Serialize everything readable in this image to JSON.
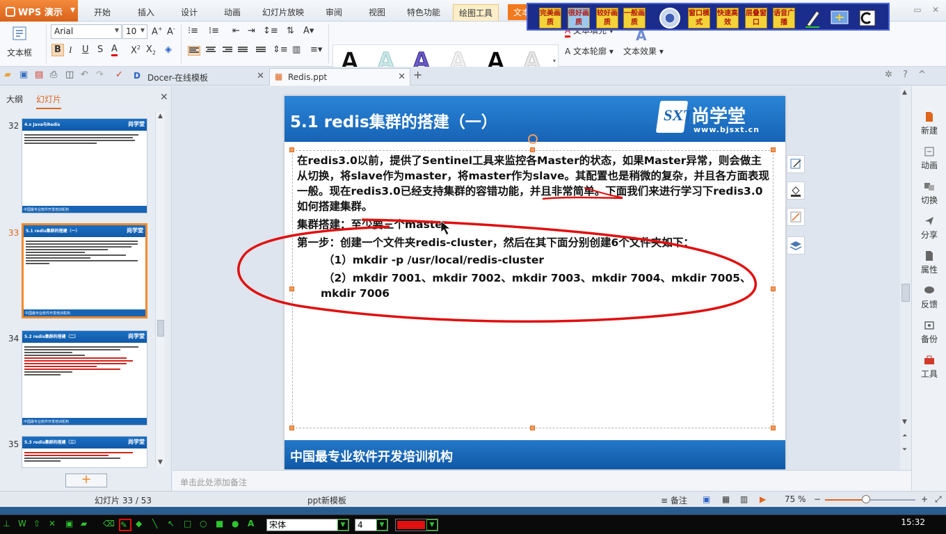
{
  "app": {
    "name": "WPS 演示",
    "menu_tabs": [
      "开始",
      "插入",
      "设计",
      "动画",
      "幻灯片放映",
      "审阅",
      "视图",
      "特色功能",
      "绘图工具",
      "文本"
    ]
  },
  "recorder_toolbar": {
    "buttons": [
      "完美画质",
      "很好画质",
      "较好画质",
      "一般画质",
      "窗口模式",
      "快速高效",
      "层叠窗口",
      "语音广播"
    ]
  },
  "ribbon": {
    "textbox_label": "文本框",
    "font_name": "Arial",
    "font_size": "10",
    "text_outline_label": "文本轮廓",
    "text_effect_label": "文本效果",
    "text_fill_label": "文本填充",
    "wordart_sample": "A"
  },
  "doc_tabs": [
    {
      "label": "Docer-在线模板"
    },
    {
      "label": "Redis.ppt"
    }
  ],
  "left_panel": {
    "tab_outline": "大纲",
    "tab_slides": "幻灯片",
    "thumbnails": [
      {
        "num": "32",
        "title": "4.x Java与Redis",
        "brand": "尚学堂",
        "footer": "中国最专业软件开发培训机构"
      },
      {
        "num": "33",
        "title": "5.1 redis集群的搭建（一）",
        "brand": "尚学堂",
        "footer": "中国最专业软件开发培训机构"
      },
      {
        "num": "34",
        "title": "5.2 redis集群的搭建（二）",
        "brand": "尚学堂",
        "footer": "中国最专业软件开发培训机构"
      },
      {
        "num": "35",
        "title": "5.3 redis集群的搭建（三）",
        "brand": "尚学堂",
        "footer": ""
      }
    ]
  },
  "slide": {
    "title": "5.1 redis集群的搭建（一）",
    "brand": "尚学堂",
    "logo_letters": "SXT",
    "url": "www.bjsxt.cn",
    "paragraph": "在redis3.0以前，提供了Sentinel工具来监控各Master的状态，如果Master异常，则会做主从切换，将slave作为master，将master作为slave。其配置也是稍微的复杂，并且各方面表现一般。现在redis3.0已经支持集群的容错功能，并且非常简单。下面我们来进行学习下redis3.0如何搭建集群。",
    "line2": "集群搭建：至少要三个master",
    "line3": "第一步：创建一个文件夹redis-cluster，然后在其下面分别创建6个文件夹如下：",
    "step1": "（1）mkdir -p /usr/local/redis-cluster",
    "step2a": "（2）mkdir 7001、mkdir 7002、mkdir 7003、mkdir 7004、mkdir 7005、",
    "step2b": "mkdir 7006",
    "footer": "中国最专业软件开发培训机构"
  },
  "task_pane": [
    "新建",
    "动画",
    "切换",
    "分享",
    "属性",
    "反馈",
    "备份",
    "工具"
  ],
  "notes_placeholder": "单击此处添加备注",
  "status": {
    "slide_counter": "幻灯片 33 / 53",
    "template": "ppt新模板",
    "notes_label": "备注",
    "zoom": "75 %",
    "zoom_level": 0.45
  },
  "anno_toolbar": {
    "font": "宋体",
    "size": "4"
  },
  "clock": "15:32",
  "colors": {
    "accent_orange": "#f27a1e",
    "slide_blue": "#1663b6",
    "annotation_red": "#e01010"
  }
}
